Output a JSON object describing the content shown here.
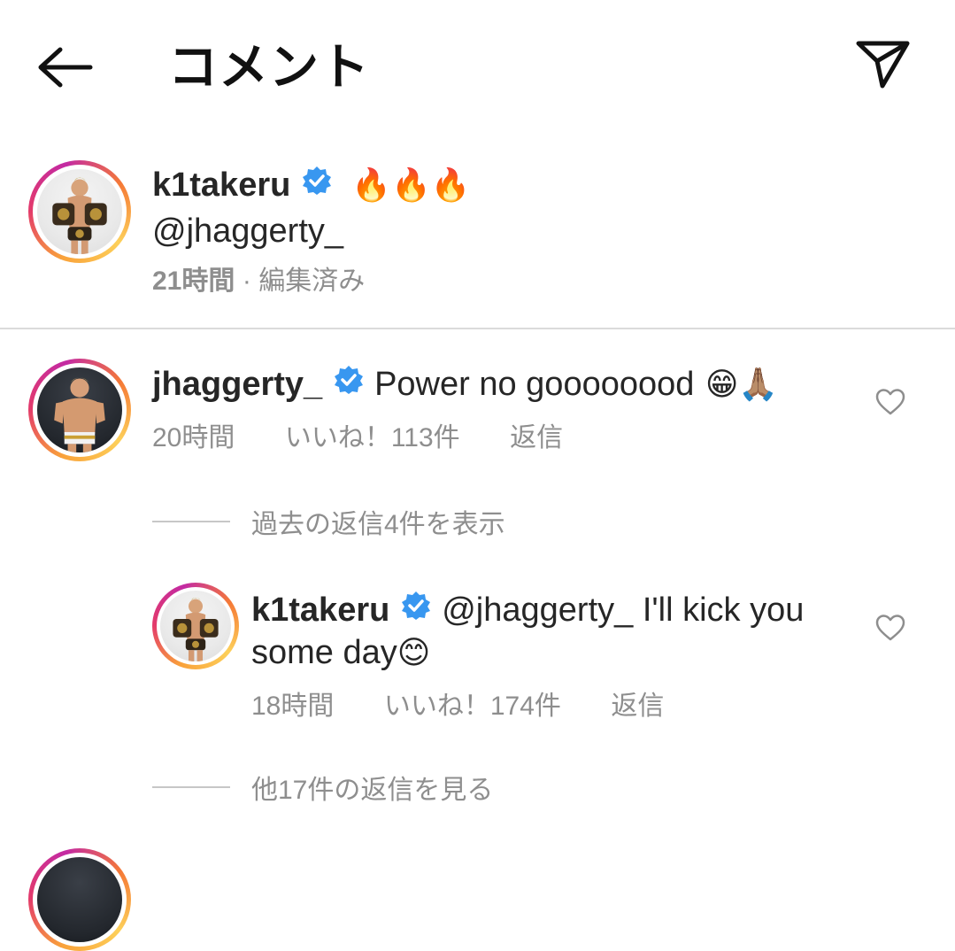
{
  "header": {
    "title": "コメント"
  },
  "caption": {
    "username": "k1takeru",
    "emoji": "🔥🔥🔥",
    "mention": "@jhaggerty_",
    "time": "21時間",
    "separator": "·",
    "edited": "編集済み"
  },
  "comment": {
    "username": "jhaggerty_",
    "text": "Power no goooooood",
    "emoji": "😁🙏🏽",
    "time": "20時間",
    "likes": "いいね！113件",
    "reply": "返信"
  },
  "previous_replies": {
    "label": "過去の返信4件を表示"
  },
  "reply": {
    "username": "k1takeru",
    "mention": "@jhaggerty_",
    "text_line1": " I'll kick you",
    "text_line2": "some day",
    "emoji": "😊",
    "time": "18時間",
    "likes": "いいね！174件",
    "reply": "返信"
  },
  "more_replies": {
    "label": "他17件の返信を見る"
  },
  "colors": {
    "verified": "#3897f0",
    "mention": "#00376b",
    "secondary_text": "#8e8e8e"
  },
  "icons": [
    "back-arrow-icon",
    "send-icon",
    "verified-badge-icon",
    "heart-icon"
  ]
}
